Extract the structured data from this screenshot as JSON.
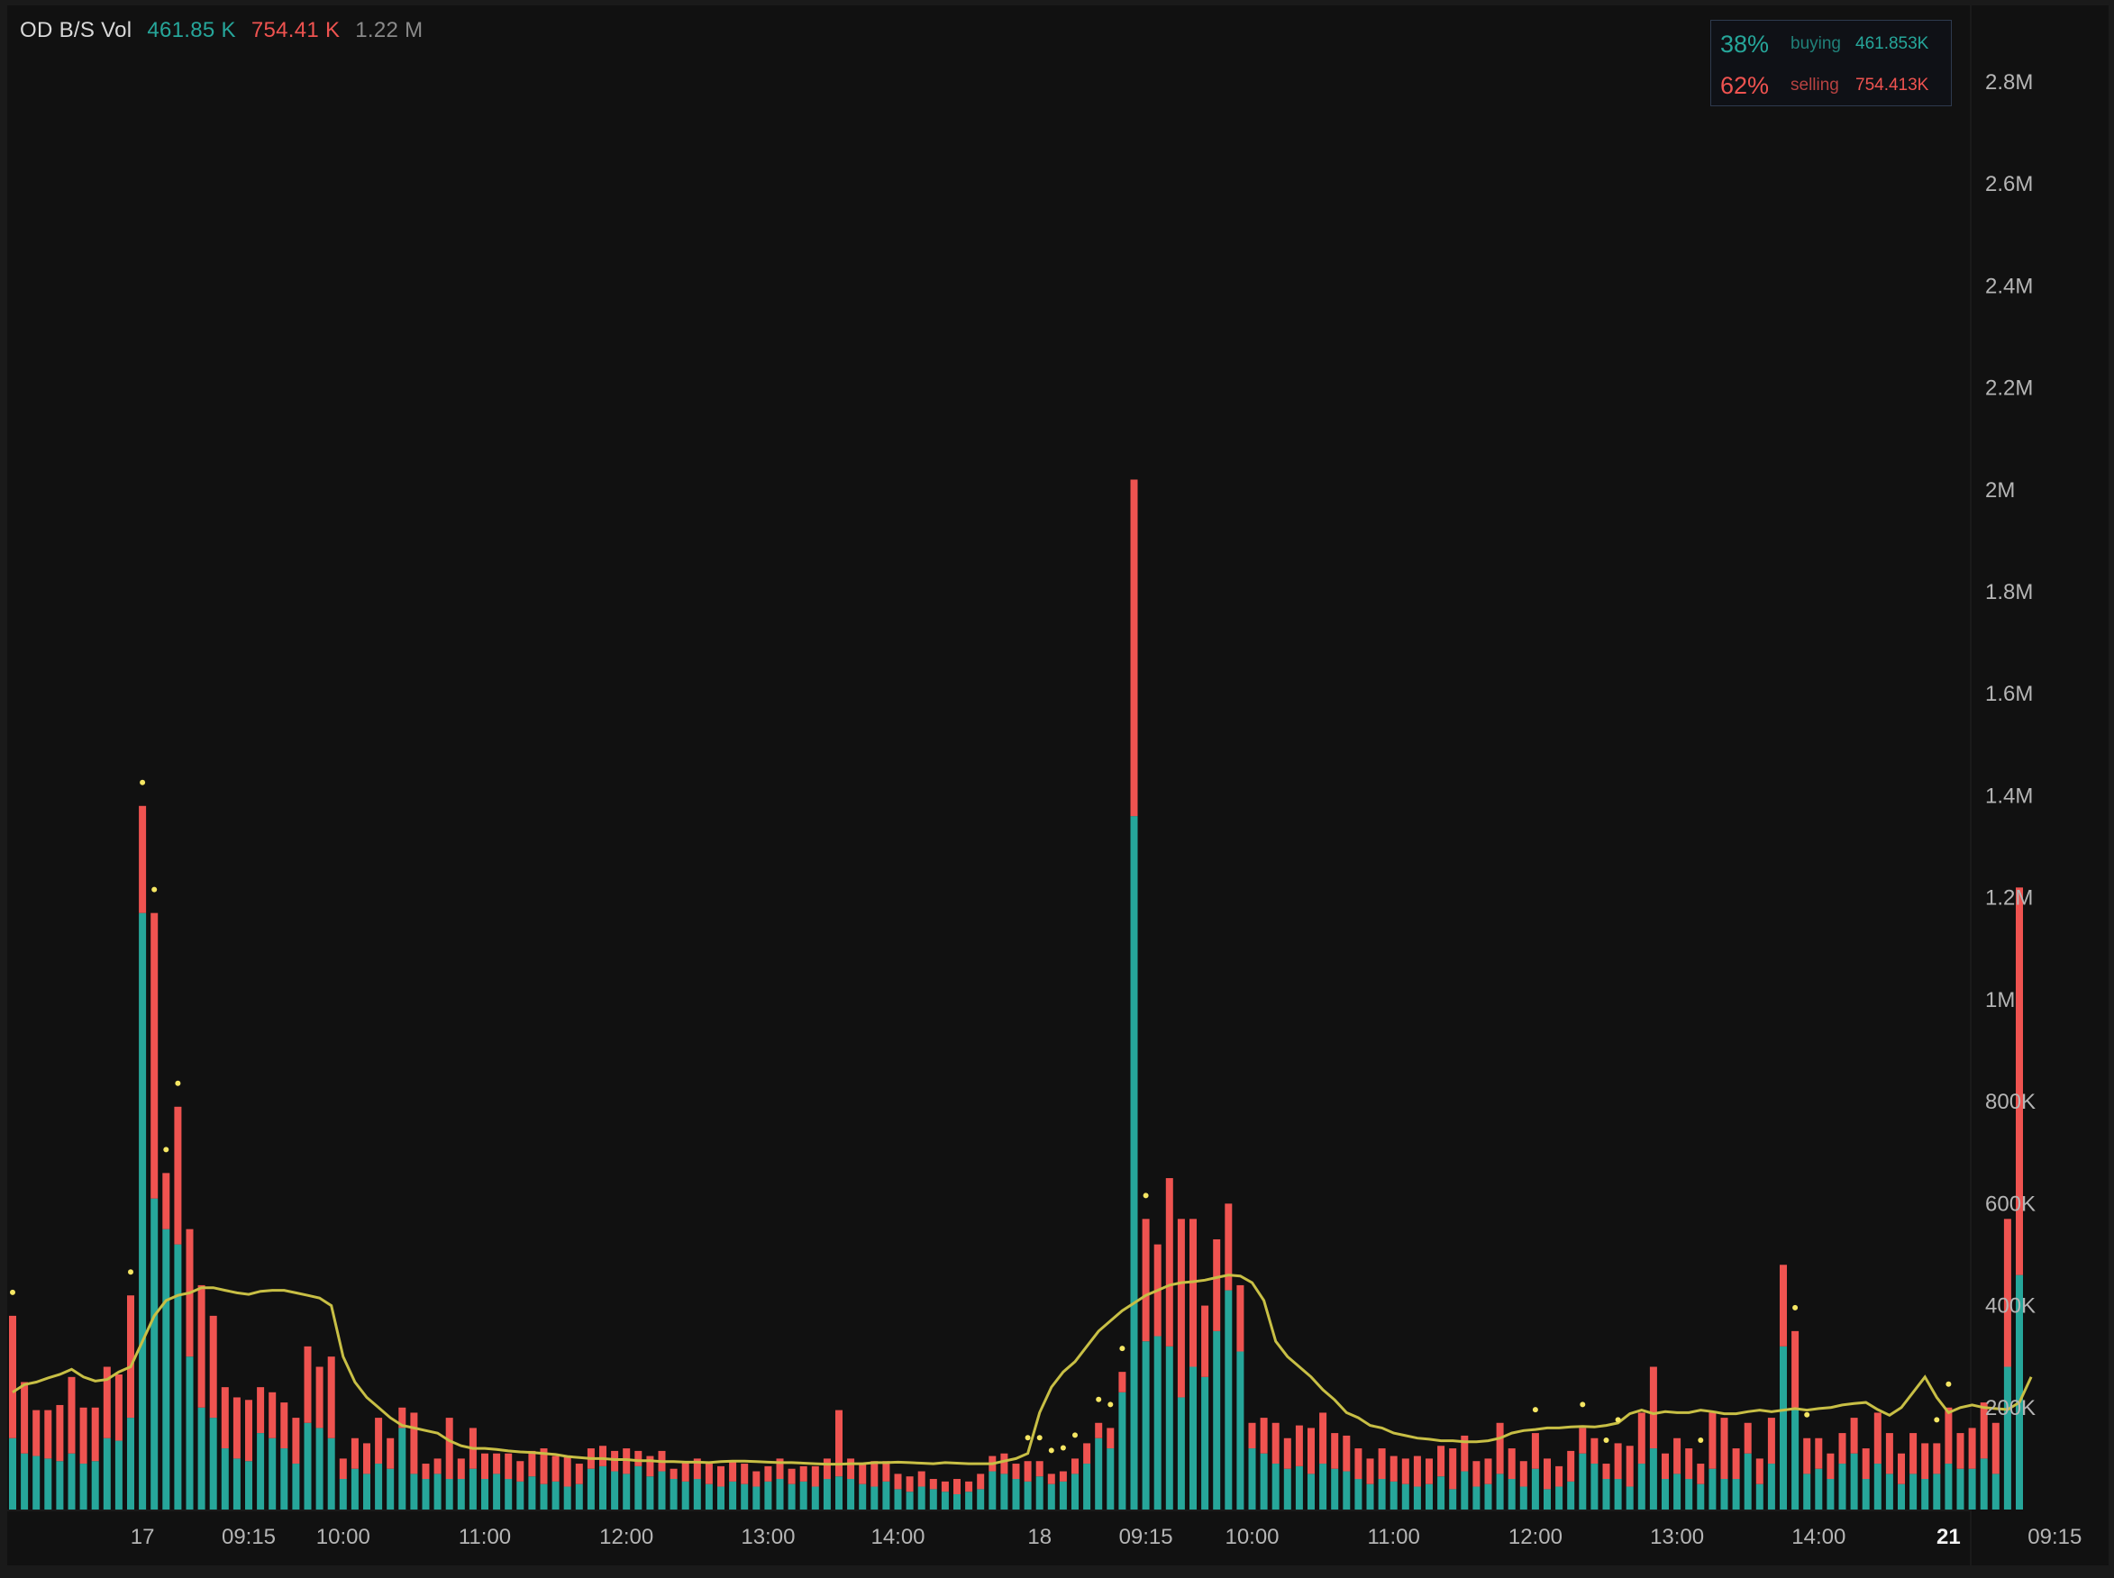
{
  "legend": {
    "title": "OD B/S Vol",
    "buy_value": "461.85 K",
    "sell_value": "754.41 K",
    "total_value": "1.22 M"
  },
  "percent_box": {
    "buy_pct": "38%",
    "buy_label": "buying",
    "buy_value": "461.853K",
    "sell_pct": "62%",
    "sell_label": "selling",
    "sell_value": "754.413K"
  },
  "colors": {
    "buy": "#26a69a",
    "sell": "#ef5350",
    "ma": "#c8bf45",
    "marker": "#f5e663",
    "axis_text": "#b5b5b5"
  },
  "chart_data": {
    "type": "bar",
    "stacked": true,
    "ylim": [
      0,
      2950000
    ],
    "y_ticks": [
      200000,
      400000,
      600000,
      800000,
      1000000,
      1200000,
      1400000,
      1600000,
      1800000,
      2000000,
      2200000,
      2400000,
      2600000,
      2800000
    ],
    "y_tick_labels": [
      "200K",
      "400K",
      "600K",
      "800K",
      "1M",
      "1.2M",
      "1.4M",
      "1.6M",
      "1.8M",
      "2M",
      "2.2M",
      "2.4M",
      "2.6M",
      "2.8M"
    ],
    "x_tick_labels": [
      {
        "label": "17",
        "bar": 11,
        "bold": false
      },
      {
        "label": "09:15",
        "bar": 20,
        "bold": false
      },
      {
        "label": "10:00",
        "bar": 28,
        "bold": false
      },
      {
        "label": "11:00",
        "bar": 40,
        "bold": false
      },
      {
        "label": "12:00",
        "bar": 52,
        "bold": false
      },
      {
        "label": "13:00",
        "bar": 64,
        "bold": false
      },
      {
        "label": "14:00",
        "bar": 75,
        "bold": false
      },
      {
        "label": "18",
        "bar": 87,
        "bold": false
      },
      {
        "label": "09:15",
        "bar": 96,
        "bold": false
      },
      {
        "label": "10:00",
        "bar": 105,
        "bold": false
      },
      {
        "label": "11:00",
        "bar": 117,
        "bold": false
      },
      {
        "label": "12:00",
        "bar": 129,
        "bold": false
      },
      {
        "label": "13:00",
        "bar": 141,
        "bold": false
      },
      {
        "label": "14:00",
        "bar": 153,
        "bold": false
      },
      {
        "label": "21",
        "bar": 164,
        "bold": true
      },
      {
        "label": "09:15",
        "bar": 173,
        "bold": false
      }
    ],
    "bar_count": 164,
    "series": [
      {
        "name": "buying",
        "values": [
          140000,
          110000,
          105000,
          100000,
          95000,
          110000,
          90000,
          95000,
          140000,
          135000,
          180000,
          1170000,
          610000,
          550000,
          520000,
          300000,
          200000,
          180000,
          120000,
          100000,
          95000,
          150000,
          140000,
          120000,
          90000,
          170000,
          160000,
          140000,
          60000,
          80000,
          70000,
          90000,
          80000,
          160000,
          70000,
          60000,
          70000,
          60000,
          60000,
          80000,
          60000,
          70000,
          60000,
          55000,
          65000,
          50000,
          55000,
          45000,
          50000,
          80000,
          85000,
          75000,
          70000,
          85000,
          65000,
          75000,
          60000,
          55000,
          60000,
          50000,
          45000,
          55000,
          50000,
          45000,
          55000,
          60000,
          50000,
          55000,
          45000,
          60000,
          65000,
          60000,
          50000,
          45000,
          55000,
          40000,
          35000,
          45000,
          40000,
          35000,
          30000,
          35000,
          40000,
          75000,
          70000,
          60000,
          55000,
          65000,
          50000,
          55000,
          70000,
          90000,
          140000,
          120000,
          230000,
          1360000,
          330000,
          340000,
          320000,
          220000,
          280000,
          260000,
          350000,
          430000,
          310000,
          120000,
          110000,
          90000,
          80000,
          85000,
          70000,
          90000,
          80000,
          75000,
          60000,
          50000,
          60000,
          55000,
          50000,
          45000,
          50000,
          65000,
          40000,
          75000,
          45000,
          50000,
          70000,
          60000,
          45000,
          80000,
          40000,
          45000,
          55000,
          110000,
          90000,
          60000,
          60000,
          45000,
          90000,
          120000,
          60000,
          70000,
          60000,
          50000,
          80000,
          60000,
          60000,
          110000,
          50000,
          90000,
          320000,
          200000,
          70000,
          80000,
          60000,
          90000,
          110000,
          60000,
          90000,
          70000,
          50000,
          70000,
          60000,
          70000,
          90000,
          80000,
          80000,
          100000,
          70000,
          280000,
          460000
        ]
      },
      {
        "name": "selling",
        "values": [
          240000,
          140000,
          90000,
          95000,
          110000,
          150000,
          110000,
          105000,
          140000,
          130000,
          240000,
          210000,
          560000,
          110000,
          270000,
          250000,
          240000,
          200000,
          120000,
          120000,
          120000,
          90000,
          90000,
          90000,
          90000,
          150000,
          120000,
          160000,
          40000,
          60000,
          60000,
          90000,
          60000,
          40000,
          120000,
          30000,
          30000,
          120000,
          40000,
          80000,
          50000,
          40000,
          50000,
          40000,
          50000,
          70000,
          50000,
          60000,
          40000,
          40000,
          40000,
          40000,
          50000,
          30000,
          40000,
          40000,
          20000,
          40000,
          40000,
          40000,
          40000,
          40000,
          40000,
          30000,
          30000,
          40000,
          30000,
          30000,
          40000,
          40000,
          130000,
          40000,
          40000,
          50000,
          40000,
          30000,
          30000,
          30000,
          20000,
          20000,
          30000,
          20000,
          30000,
          30000,
          40000,
          30000,
          40000,
          30000,
          20000,
          20000,
          30000,
          40000,
          30000,
          40000,
          40000,
          660000,
          240000,
          180000,
          330000,
          350000,
          290000,
          140000,
          180000,
          170000,
          130000,
          50000,
          70000,
          80000,
          60000,
          80000,
          90000,
          100000,
          70000,
          70000,
          60000,
          50000,
          60000,
          50000,
          50000,
          60000,
          50000,
          60000,
          80000,
          70000,
          50000,
          50000,
          100000,
          60000,
          50000,
          70000,
          60000,
          40000,
          60000,
          50000,
          50000,
          30000,
          70000,
          80000,
          100000,
          160000,
          50000,
          70000,
          60000,
          40000,
          110000,
          120000,
          60000,
          60000,
          50000,
          90000,
          160000,
          150000,
          70000,
          60000,
          50000,
          60000,
          70000,
          60000,
          100000,
          80000,
          60000,
          80000,
          70000,
          60000,
          110000,
          70000,
          80000,
          110000,
          100000,
          290000,
          760000
        ]
      },
      {
        "name": "moving_average",
        "values": [
          230000,
          245000,
          250000,
          258000,
          265000,
          275000,
          260000,
          252000,
          255000,
          270000,
          280000,
          330000,
          380000,
          410000,
          420000,
          425000,
          435000,
          435000,
          430000,
          425000,
          422000,
          428000,
          430000,
          430000,
          425000,
          420000,
          415000,
          400000,
          300000,
          250000,
          220000,
          200000,
          180000,
          165000,
          160000,
          155000,
          150000,
          135000,
          125000,
          120000,
          120000,
          118000,
          115000,
          113000,
          112000,
          110000,
          108000,
          104000,
          102000,
          100000,
          100000,
          98000,
          98000,
          96000,
          96000,
          94000,
          94000,
          93000,
          93000,
          92000,
          94000,
          95000,
          95000,
          94000,
          93000,
          92000,
          92000,
          91000,
          90000,
          89000,
          89000,
          90000,
          90000,
          92000,
          92000,
          93000,
          92000,
          91000,
          90000,
          92000,
          91000,
          90000,
          90000,
          90000,
          95000,
          100000,
          110000,
          190000,
          240000,
          270000,
          290000,
          320000,
          350000,
          370000,
          390000,
          405000,
          420000,
          430000,
          440000,
          445000,
          447000,
          450000,
          455000,
          460000,
          458000,
          445000,
          410000,
          330000,
          300000,
          280000,
          260000,
          235000,
          215000,
          190000,
          180000,
          165000,
          160000,
          150000,
          145000,
          140000,
          138000,
          135000,
          135000,
          133000,
          133000,
          135000,
          140000,
          150000,
          155000,
          157000,
          160000,
          160000,
          162000,
          163000,
          162000,
          165000,
          170000,
          188000,
          195000,
          188000,
          192000,
          190000,
          190000,
          195000,
          192000,
          188000,
          188000,
          192000,
          195000,
          192000,
          195000,
          198000,
          195000,
          198000,
          200000,
          205000,
          208000,
          210000,
          196000,
          185000,
          200000,
          230000,
          260000,
          220000,
          190000,
          200000,
          205000,
          200000,
          198000,
          196000,
          210000,
          260000
        ]
      }
    ],
    "markers": [
      0,
      10,
      11,
      12,
      13,
      14,
      86,
      87,
      88,
      89,
      90,
      92,
      93,
      94,
      96,
      129,
      133,
      135,
      136,
      143,
      151,
      152,
      163,
      164
    ]
  }
}
